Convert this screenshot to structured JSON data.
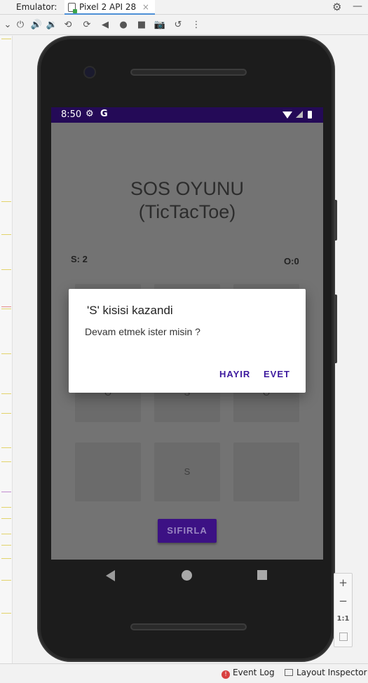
{
  "ide": {
    "emulator_label": "Emulator:",
    "tab_title": "Pixel 2 API 28",
    "tab_close": "×",
    "settings_glyph": "⚙",
    "minimize_glyph": "—"
  },
  "toolbar": {
    "icons": [
      "power-icon",
      "volume-up-icon",
      "volume-down-icon",
      "rotate-left-icon",
      "rotate-right-icon",
      "back-icon",
      "home-icon",
      "overview-icon",
      "screenshot-icon",
      "snapshot-icon",
      "more-icon"
    ],
    "glyphs": [
      "⏻",
      "🔊",
      "🔉",
      "⟲",
      "⟳",
      "◀",
      "●",
      "■",
      "📷",
      "↺",
      "⋮"
    ]
  },
  "status_bar": {
    "time": "8:50",
    "settings_glyph": "⚙",
    "google_glyph": "G"
  },
  "app": {
    "title": "SOS OYUNU\n(TicTacToe)",
    "score_left": "S: 2",
    "score_right": "O:0",
    "cells": [
      "",
      "",
      "",
      "O",
      "S",
      "O",
      "",
      "S",
      ""
    ],
    "reset_label": "SIFIRLA"
  },
  "dialog": {
    "title": "'S' kisisi kazandi",
    "message": "Devam etmek ister misin ?",
    "negative_label": "HAYIR",
    "positive_label": "EVET"
  },
  "zoom_panel": {
    "zoom_in": "+",
    "zoom_out": "−",
    "actual_size": "1:1"
  },
  "bottom_bar": {
    "event_log": "Event Log",
    "event_log_badge": "!",
    "layout_inspector": "Layout Inspector"
  },
  "colors": {
    "status_bar": "#240a57",
    "dialog_accent": "#3d1a9e",
    "reset_button": "#3c1184",
    "dim_overlay": "#737373"
  }
}
